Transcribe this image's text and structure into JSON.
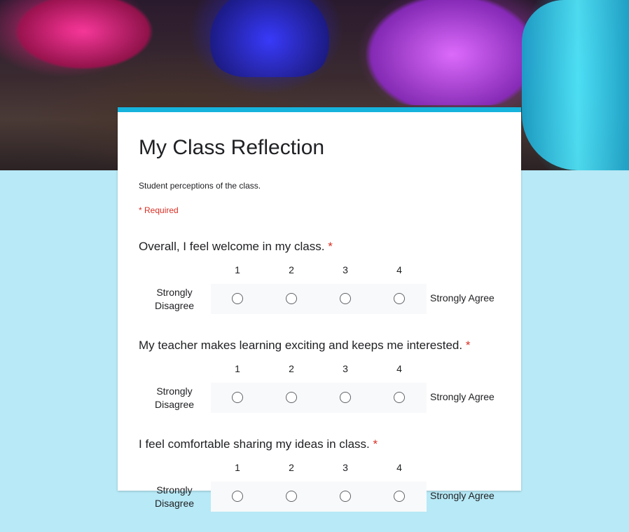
{
  "form": {
    "title": "My Class Reflection",
    "description": "Student perceptions of the class.",
    "required_note": "* Required",
    "accent_color": "#16b3dd",
    "background_color": "#b7e9f6",
    "banner_image": "chemistry-flasks-photo"
  },
  "questions": [
    {
      "text": "Overall, I feel welcome in my class.",
      "required_mark": "*",
      "scale": [
        "1",
        "2",
        "3",
        "4"
      ],
      "low_label": "Strongly Disagree",
      "high_label": "Strongly Agree"
    },
    {
      "text": "My teacher makes learning exciting and keeps me interested.",
      "required_mark": "*",
      "scale": [
        "1",
        "2",
        "3",
        "4"
      ],
      "low_label": "Strongly Disagree",
      "high_label": "Strongly Agree"
    },
    {
      "text": "I feel comfortable sharing my ideas in class.",
      "required_mark": "*",
      "scale": [
        "1",
        "2",
        "3",
        "4"
      ],
      "low_label": "Strongly Disagree",
      "high_label": "Strongly Agree"
    }
  ]
}
